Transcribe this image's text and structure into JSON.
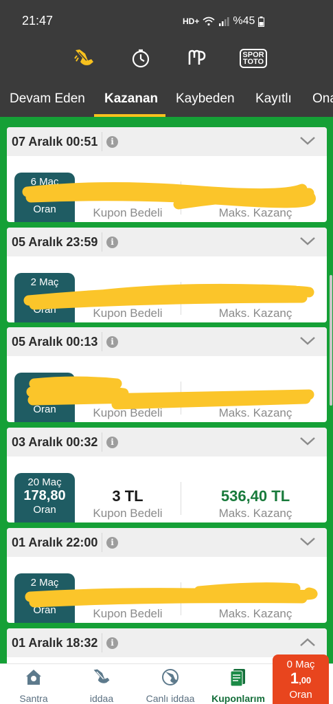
{
  "status_bar": {
    "time": "21:47",
    "network": "HD+",
    "battery": "%45"
  },
  "top_nav": {
    "icons": [
      "iddaa-hand-icon",
      "stopwatch-icon",
      "mp-logo-icon",
      "spor-toto-logo-icon"
    ],
    "spor_toto_label_1": "SPOR",
    "spor_toto_label_2": "TOTO"
  },
  "tabs": [
    {
      "label": "Devam Eden",
      "active": false
    },
    {
      "label": "Kazanan",
      "active": true
    },
    {
      "label": "Kaybeden",
      "active": false
    },
    {
      "label": "Kayıtlı",
      "active": false
    },
    {
      "label": "Ona",
      "active": false
    }
  ],
  "labels": {
    "oran": "Oran",
    "kupon_bedeli": "Kupon Bedeli",
    "maks_kazanc": "Maks. Kazanç",
    "info": "i"
  },
  "coupons": [
    {
      "date": "07 Aralık 00:51",
      "matches": "6 Maç",
      "odds": "",
      "stake": "",
      "max_win": "",
      "expanded": false
    },
    {
      "date": "05 Aralık 23:59",
      "matches": "2 Maç",
      "odds": "",
      "stake": "",
      "max_win": "",
      "expanded": false
    },
    {
      "date": "05 Aralık 00:13",
      "matches": "",
      "odds": "",
      "stake": "",
      "max_win": "",
      "expanded": false
    },
    {
      "date": "03 Aralık 00:32",
      "matches": "20 Maç",
      "odds": "178,80",
      "stake": "3 TL",
      "max_win": "536,40 TL",
      "expanded": false
    },
    {
      "date": "01 Aralık 22:00",
      "matches": "2 Maç",
      "odds": "",
      "stake": "",
      "max_win": "",
      "expanded": false
    },
    {
      "date": "01 Aralık 18:32",
      "matches": "",
      "odds": "",
      "stake": "",
      "max_win": "",
      "expanded": true
    }
  ],
  "bottom_nav": [
    {
      "label": "Santra",
      "icon": "home-icon",
      "active": false
    },
    {
      "label": "iddaa",
      "icon": "iddaa-hand-icon",
      "active": false
    },
    {
      "label": "Canlı iddaa",
      "icon": "live-iddaa-icon",
      "active": false
    },
    {
      "label": "Kuponlarım",
      "icon": "coupons-icon",
      "active": true
    }
  ],
  "betslip": {
    "matches": "0 Maç",
    "odds_main": "1",
    "odds_decimal": ",00",
    "label": "Oran"
  },
  "colors": {
    "bar": "#3b3b3b",
    "accent_yellow": "#f7c11e",
    "green": "#15a036",
    "badge": "#1f5c63",
    "win_green": "#187a3b",
    "slip": "#e8451e",
    "redaction": "#fbc52a"
  }
}
